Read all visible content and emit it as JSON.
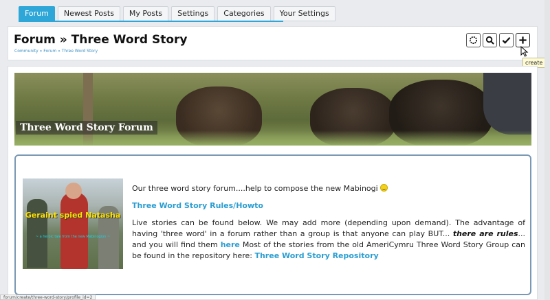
{
  "tabs": [
    {
      "label": "Forum",
      "active": true
    },
    {
      "label": "Newest Posts"
    },
    {
      "label": "My Posts"
    },
    {
      "label": "Settings"
    },
    {
      "label": "Categories"
    },
    {
      "label": "Your Settings"
    }
  ],
  "header": {
    "title": "Forum » Three Word Story",
    "breadcrumb": "Community » Forum » Three Word Story"
  },
  "toolbar": {
    "icons": [
      "circle-dots-icon",
      "search-icon",
      "checkmark-icon",
      "plus-icon"
    ],
    "tooltip": "create"
  },
  "banner": {
    "title": "Three Word Story Forum"
  },
  "card": {
    "photo_caption": "Geraint spied Natasha",
    "photo_subcaption": "~ a heroic tale from the new Mabinogion ~",
    "intro_text": "Our three word story forum....help to compose the new Mabinogi",
    "rules_link": "Three Word Story Rules/Howto",
    "body_part1": "Live stories can be found below. We may add more (depending upon demand). The advantage of having 'three word' in a forum rather than a group is that anyone can play BUT...",
    "body_em": "there are rules",
    "body_part2": "... and you will find them",
    "here_link": "here",
    "body_part3": "Most of the stories from the old AmeriCymru Three Word Story Group can be found in the repository here:",
    "repo_link": "Three Word Story Repository"
  },
  "status": {
    "url": "forum/create/three-word-story/profile_id=2"
  },
  "colors": {
    "accent": "#2ea7d8",
    "link": "#2a9dd1",
    "card_border": "#7a98b5"
  }
}
